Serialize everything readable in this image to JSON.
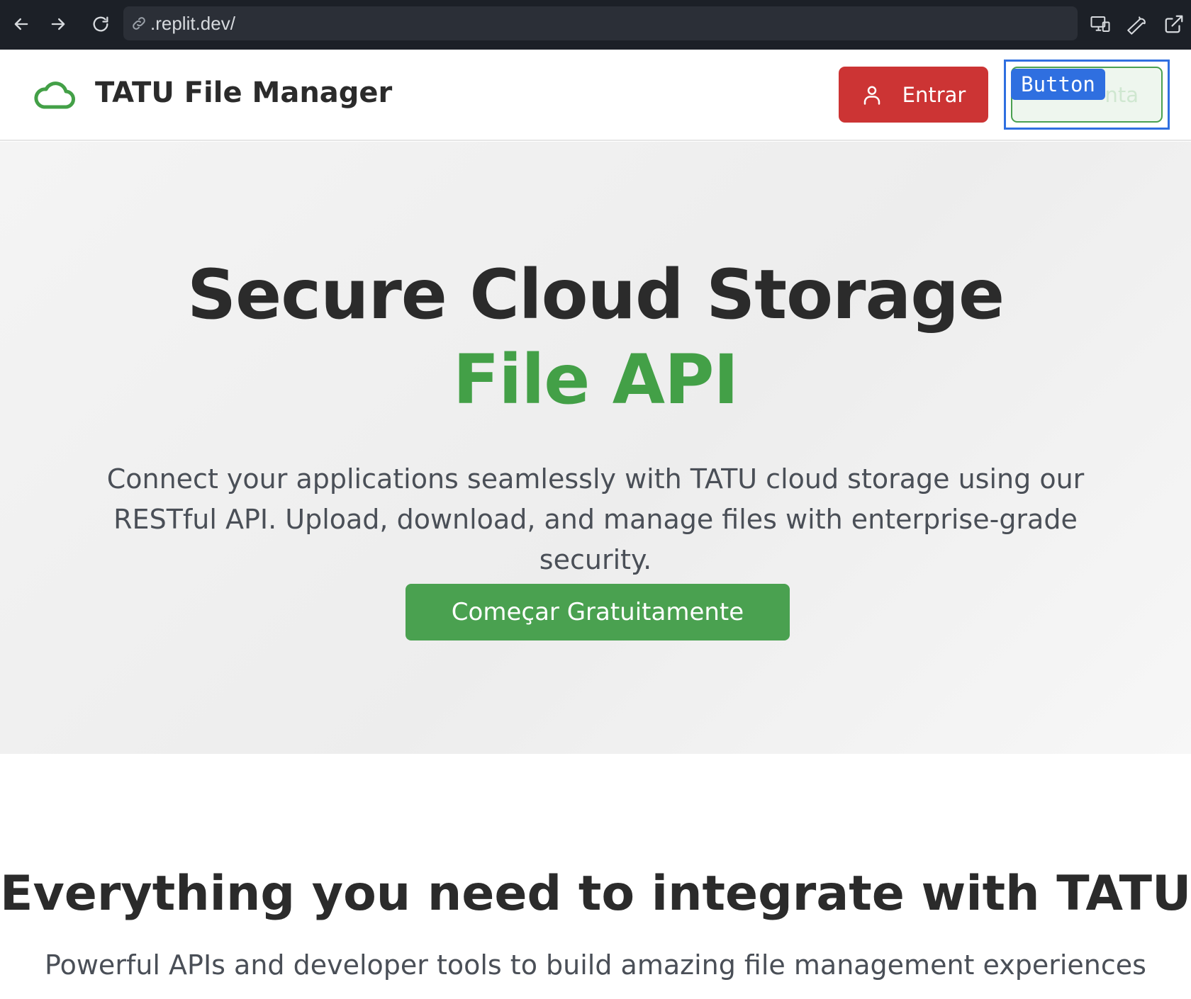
{
  "browser": {
    "url": ".replit.dev/",
    "icons": {
      "back": "arrow-left-icon",
      "forward": "arrow-right-icon",
      "reload": "reload-icon",
      "link": "link-icon",
      "devices": "devices-icon",
      "tools": "wrench-icon",
      "external": "external-link-icon"
    },
    "colors": {
      "bar": "#1c2027",
      "url_box": "#2b2f37"
    }
  },
  "header": {
    "brand_title": "TATU File Manager",
    "brand_icon": "cloud-icon",
    "login_label": "Entrar",
    "login_icon": "user-icon",
    "signup_label_fragment": "nta",
    "highlight_tag": "Button"
  },
  "hero": {
    "title": "Secure Cloud Storage",
    "accent": "File API",
    "description": "Connect your applications seamlessly with TATU cloud storage using our RESTful API. Upload, download, and manage files with enterprise-grade security.",
    "cta_label": "Começar Gratuitamente"
  },
  "features": {
    "title": "Everything you need to integrate with TATU",
    "subtitle": "Powerful APIs and developer tools to build amazing file management experiences"
  },
  "colors": {
    "accent_green": "#43a047",
    "button_green": "#4aa150",
    "login_red": "#cc3434",
    "highlight_blue": "#2f6fe0",
    "text_dark": "#2b2b2b",
    "text_muted": "#4a4f57"
  }
}
